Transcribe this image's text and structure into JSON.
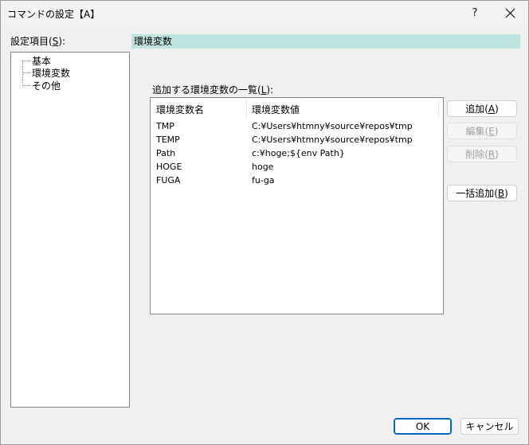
{
  "window": {
    "title": "コマンドの設定【A】",
    "help_label": "?"
  },
  "left": {
    "label": "設定項目(",
    "label_access": "S",
    "label_end": "):",
    "tree_items": [
      {
        "label": "基本"
      },
      {
        "label": "環境変数",
        "selected": true
      },
      {
        "label": "その他"
      }
    ]
  },
  "section": {
    "header": "環境変数",
    "list_label": "追加する環境変数の一覧(",
    "list_label_access": "L",
    "list_label_end": "):"
  },
  "table": {
    "columns": [
      "環境変数名",
      "環境変数値"
    ],
    "rows": [
      [
        "TMP",
        "C:¥Users¥htmny¥source¥repos¥tmp"
      ],
      [
        "TEMP",
        "C:¥Users¥htmny¥source¥repos¥tmp"
      ],
      [
        "Path",
        "c:¥hoge;${env Path}"
      ],
      [
        "HOGE",
        "hoge"
      ],
      [
        "FUGA",
        "fu-ga"
      ]
    ]
  },
  "buttons": {
    "add": {
      "text": "追加(",
      "key": "A",
      "end": ")",
      "enabled": true
    },
    "edit": {
      "text": "編集(",
      "key": "E",
      "end": ")",
      "enabled": false
    },
    "delete": {
      "text": "削除(",
      "key": "R",
      "end": ")",
      "enabled": false
    },
    "bulk_add": {
      "text": "一括追加(",
      "key": "B",
      "end": ")",
      "enabled": true
    },
    "ok": "OK",
    "cancel": "キャンセル"
  },
  "colors": {
    "section_header_bg": "#bfe3df",
    "default_button_border": "#0067c0"
  },
  "icons": {
    "close": "close-icon"
  }
}
